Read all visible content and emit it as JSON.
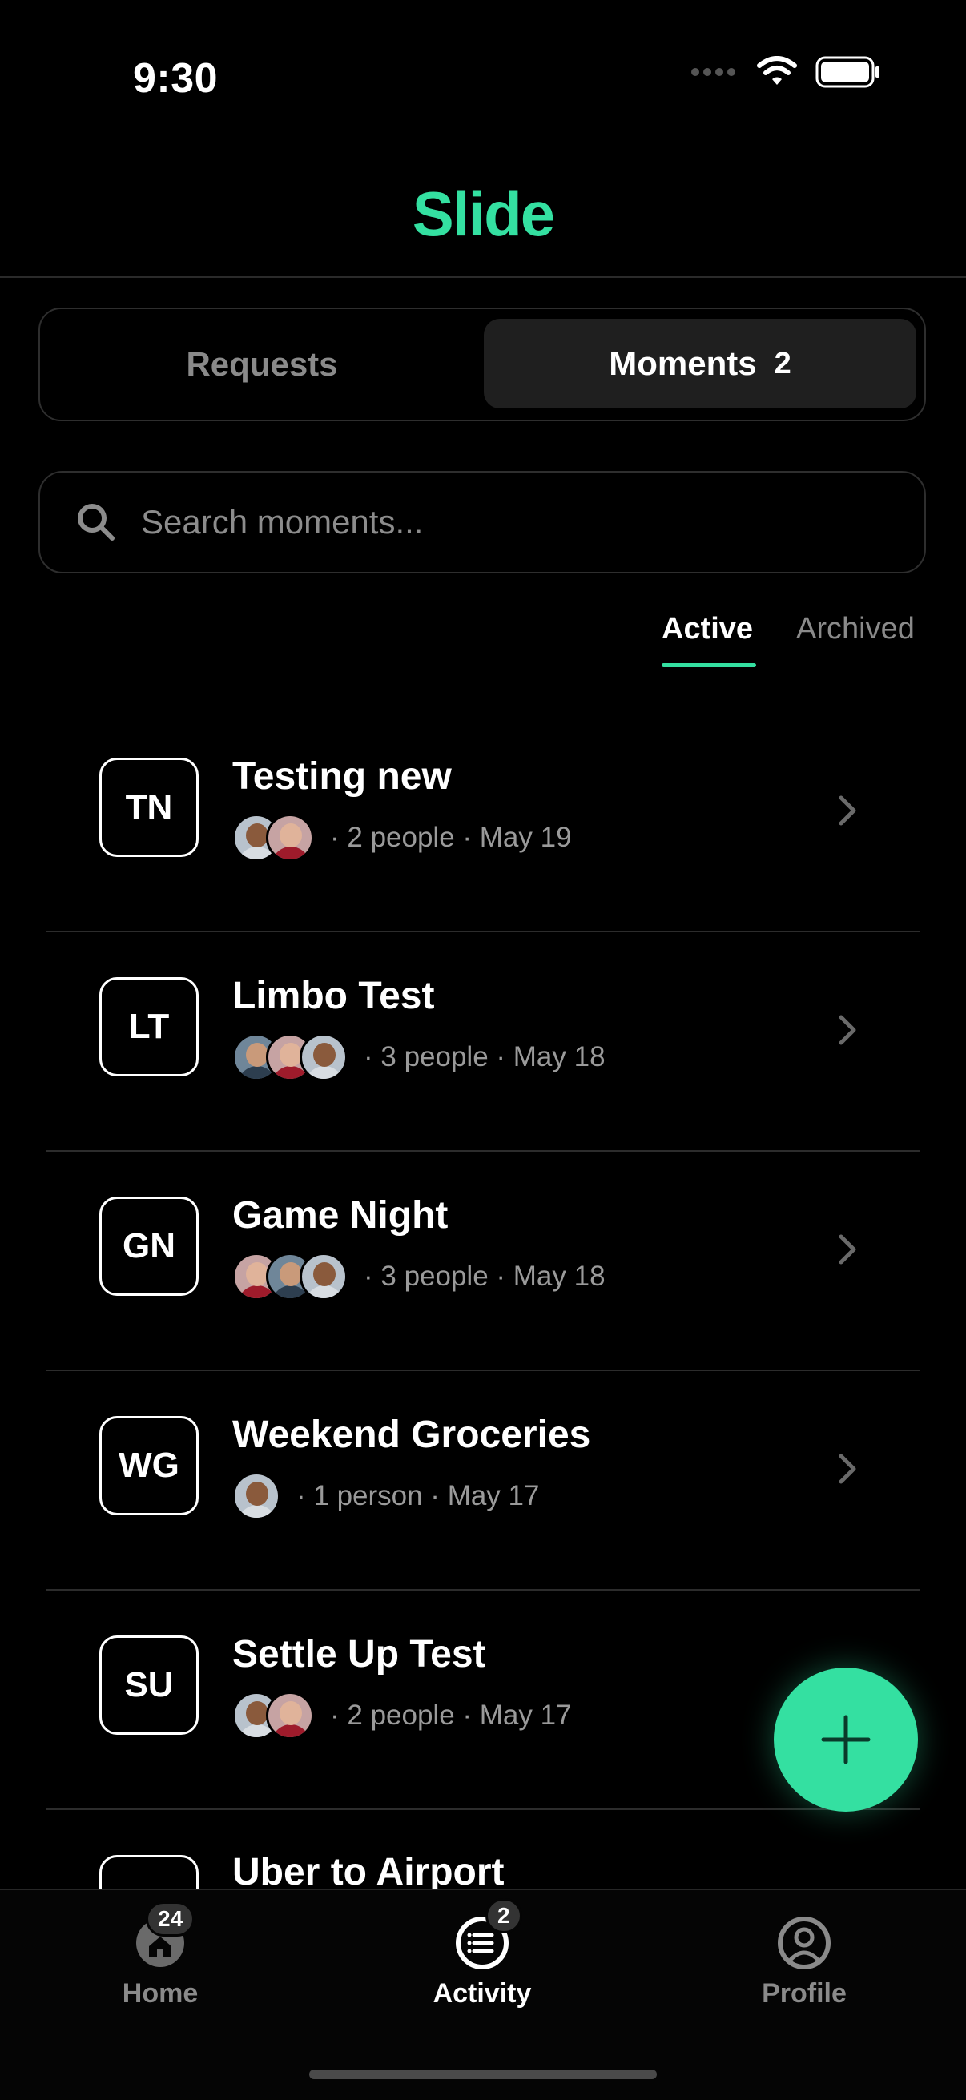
{
  "status_bar": {
    "time": "9:30"
  },
  "header": {
    "logo": "Slide"
  },
  "segmented": {
    "requests_label": "Requests",
    "moments_label": "Moments",
    "moments_count": "2"
  },
  "search": {
    "placeholder": "Search moments..."
  },
  "filters": {
    "active": "Active",
    "archived": "Archived"
  },
  "moments": [
    {
      "initials": "TN",
      "title": "Testing new",
      "meta": "· 2 people · May 19",
      "avatars": [
        "man",
        "woman"
      ]
    },
    {
      "initials": "LT",
      "title": "Limbo Test",
      "meta": "· 3 people · May 18",
      "avatars": [
        "man2",
        "woman",
        "man"
      ]
    },
    {
      "initials": "GN",
      "title": "Game Night",
      "meta": "· 3 people · May 18",
      "avatars": [
        "woman",
        "man2",
        "man"
      ]
    },
    {
      "initials": "WG",
      "title": "Weekend Groceries",
      "meta": "· 1 person · May 17",
      "avatars": [
        "man"
      ]
    },
    {
      "initials": "SU",
      "title": "Settle Up Test",
      "meta": "· 2 people · May 17",
      "avatars": [
        "man",
        "woman"
      ]
    }
  ],
  "partial_moment": {
    "title": "Uber to Airport"
  },
  "tabbar": {
    "home": {
      "label": "Home",
      "badge": "24"
    },
    "activity": {
      "label": "Activity",
      "badge": "2"
    },
    "profile": {
      "label": "Profile"
    }
  },
  "colors": {
    "accent": "#34E0A1",
    "background": "#000000",
    "muted": "#8a8a8a"
  },
  "icons": [
    "search-icon",
    "chevron-right-icon",
    "plus-icon",
    "home-icon",
    "activity-icon",
    "profile-icon",
    "wifi-icon",
    "battery-icon",
    "signal-icon"
  ]
}
